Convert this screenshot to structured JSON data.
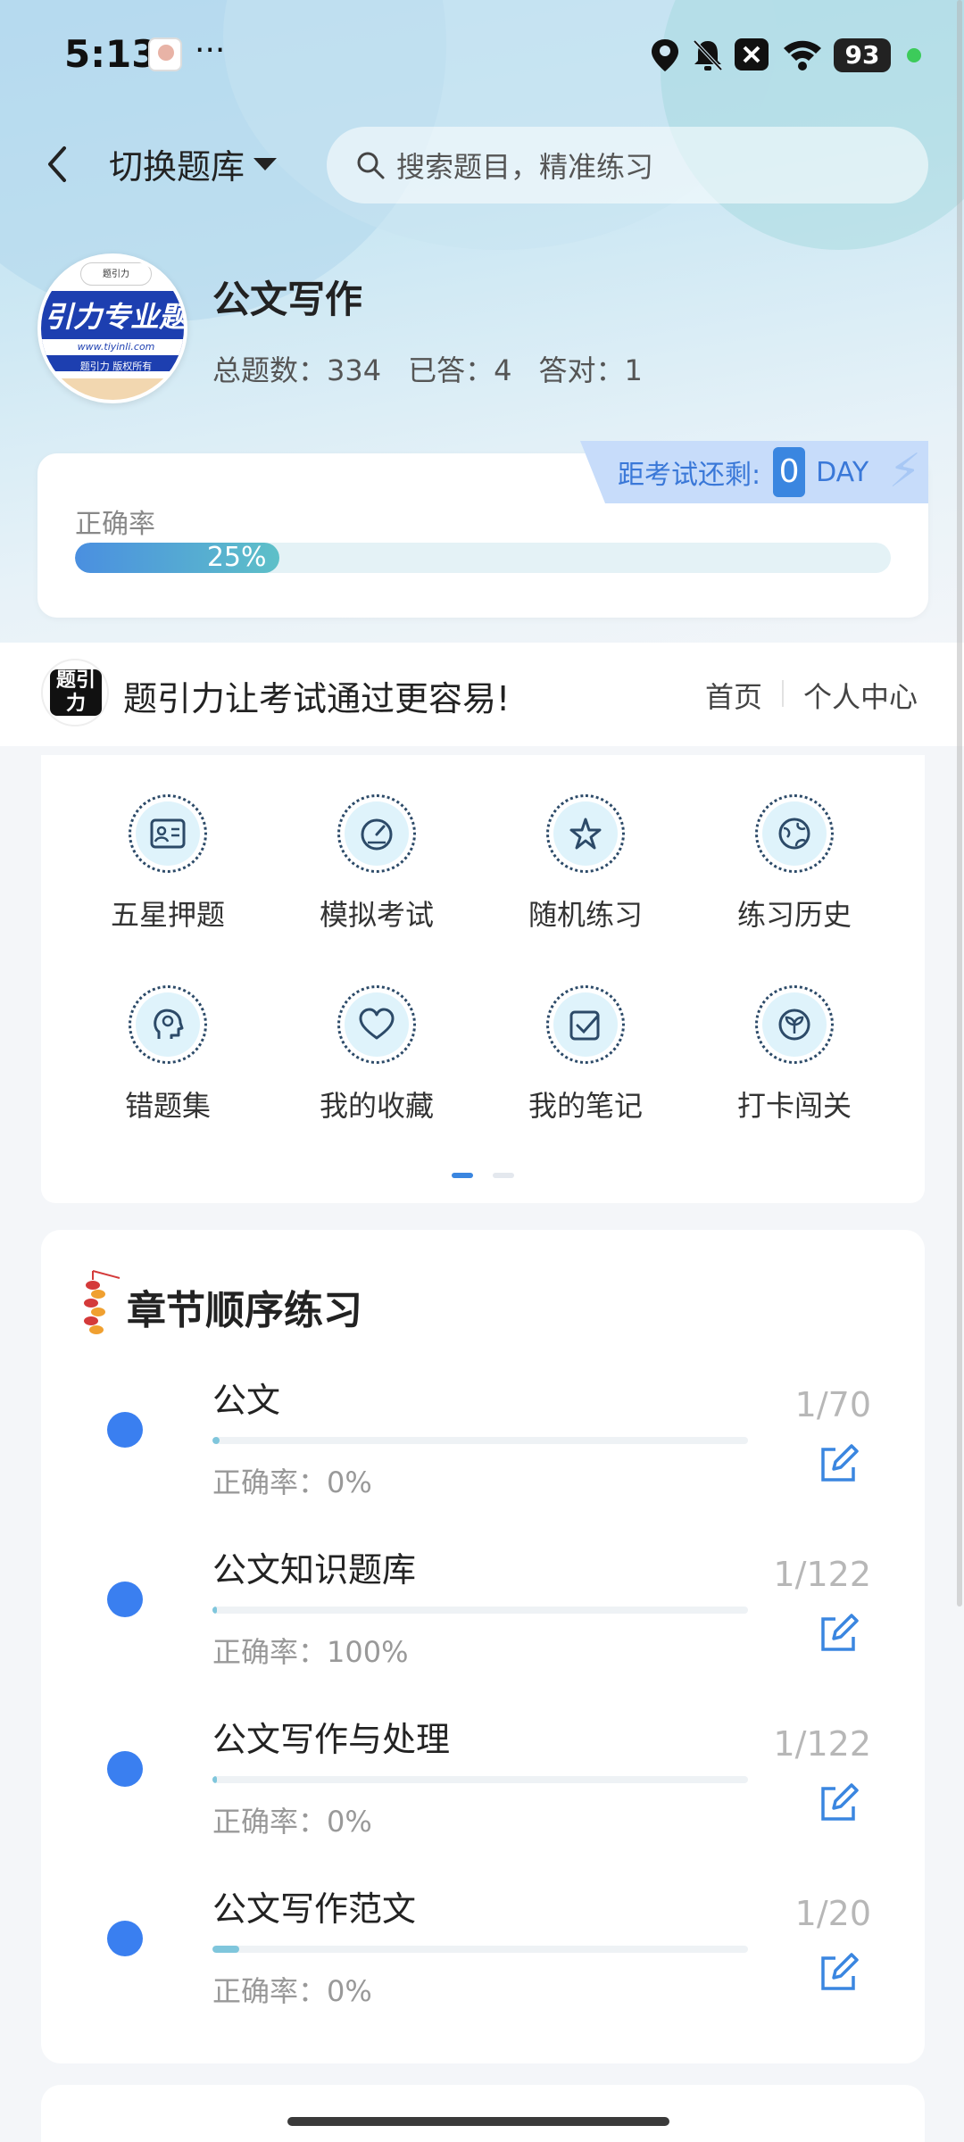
{
  "status_bar": {
    "time": "5:13",
    "dots": "···",
    "battery": "93"
  },
  "header": {
    "switch_label": "切换题库",
    "search_placeholder": "搜索题目，精准练习"
  },
  "logo": {
    "top_tag": "题引力",
    "band_text": "引力专业题",
    "url": "www.tiyinli.com",
    "copyright": "题引力 版权所有"
  },
  "bank": {
    "title": "公文写作",
    "total_label": "总题数：334",
    "answered_label": "已答：4",
    "correct_label": "答对：1"
  },
  "exam": {
    "label": "距考试还剩:",
    "days": "0",
    "unit": "DAY"
  },
  "accuracy": {
    "label": "正确率",
    "percent_text": "25%",
    "percent": 25
  },
  "slogan": {
    "logo_text": "题引力",
    "text": "题引力让考试通过更容易!",
    "nav_home": "首页",
    "nav_center": "个人中心"
  },
  "features": [
    {
      "label": "五星押题",
      "icon": "id-card-icon"
    },
    {
      "label": "模拟考试",
      "icon": "speedometer-icon"
    },
    {
      "label": "随机练习",
      "icon": "shuffle-star-icon"
    },
    {
      "label": "练习历史",
      "icon": "globe-icon"
    },
    {
      "label": "错题集",
      "icon": "head-icon"
    },
    {
      "label": "我的收藏",
      "icon": "heart-icon"
    },
    {
      "label": "我的笔记",
      "icon": "checkbox-icon"
    },
    {
      "label": "打卡闯关",
      "icon": "sprout-icon"
    }
  ],
  "chapters": {
    "title": "章节顺序练习",
    "items": [
      {
        "name": "公文",
        "rate": "正确率：0%",
        "progress": "1/70",
        "fraction": 0.014
      },
      {
        "name": "公文知识题库",
        "rate": "正确率：100%",
        "progress": "1/122",
        "fraction": 0.008
      },
      {
        "name": "公文写作与处理",
        "rate": "正确率：0%",
        "progress": "1/122",
        "fraction": 0.008
      },
      {
        "name": "公文写作范文",
        "rate": "正确率：0%",
        "progress": "1/20",
        "fraction": 0.05
      }
    ]
  },
  "colors": {
    "accent": "#3a86e0",
    "bullet": "#3a7ff0",
    "icon_bg": "#dff3fb"
  }
}
